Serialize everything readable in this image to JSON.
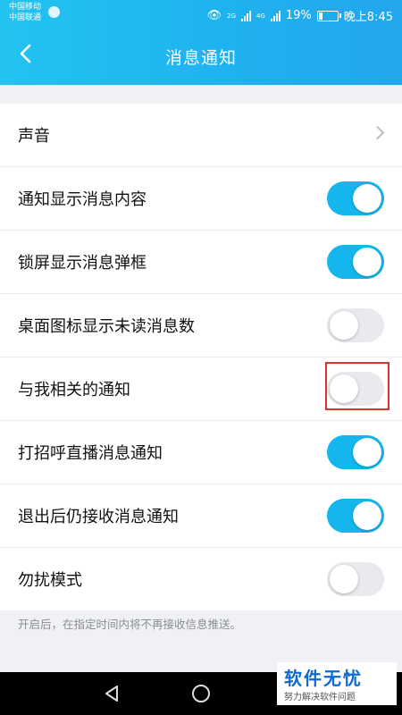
{
  "status_bar": {
    "carrier_1": "中国移动",
    "carrier_2": "中国联通",
    "network_2g": "2G",
    "network_4g": "4G",
    "battery": "19%",
    "battery_level": 0.19,
    "time": "晚上8:45"
  },
  "header": {
    "title": "消息通知",
    "back_icon": "chevron-left-icon",
    "background_color": "#1fb2f0"
  },
  "settings": [
    {
      "label": "声音",
      "type": "link"
    },
    {
      "label": "通知显示消息内容",
      "type": "toggle",
      "on": true
    },
    {
      "label": "锁屏显示消息弹框",
      "type": "toggle",
      "on": true
    },
    {
      "label": "桌面图标显示未读消息数",
      "type": "toggle",
      "on": false
    },
    {
      "label": "与我相关的通知",
      "type": "toggle",
      "on": false,
      "highlighted": true
    },
    {
      "label": "打招呼直播消息通知",
      "type": "toggle",
      "on": true
    },
    {
      "label": "退出后仍接收消息通知",
      "type": "toggle",
      "on": true
    },
    {
      "label": "勿扰模式",
      "type": "toggle",
      "on": false
    }
  ],
  "footnote": "开启后，在指定时间内将不再接收信息推送。",
  "colors": {
    "toggle_on": "#15b6ee",
    "toggle_off": "#e9eaee",
    "highlight": "#d9322f"
  },
  "nav_bar": {
    "back": "triangle-back-icon",
    "home": "circle-home-icon",
    "recents": "square-recents-icon"
  },
  "watermark": {
    "title": "软件无忧",
    "subtitle": "努力解决软件问题"
  }
}
